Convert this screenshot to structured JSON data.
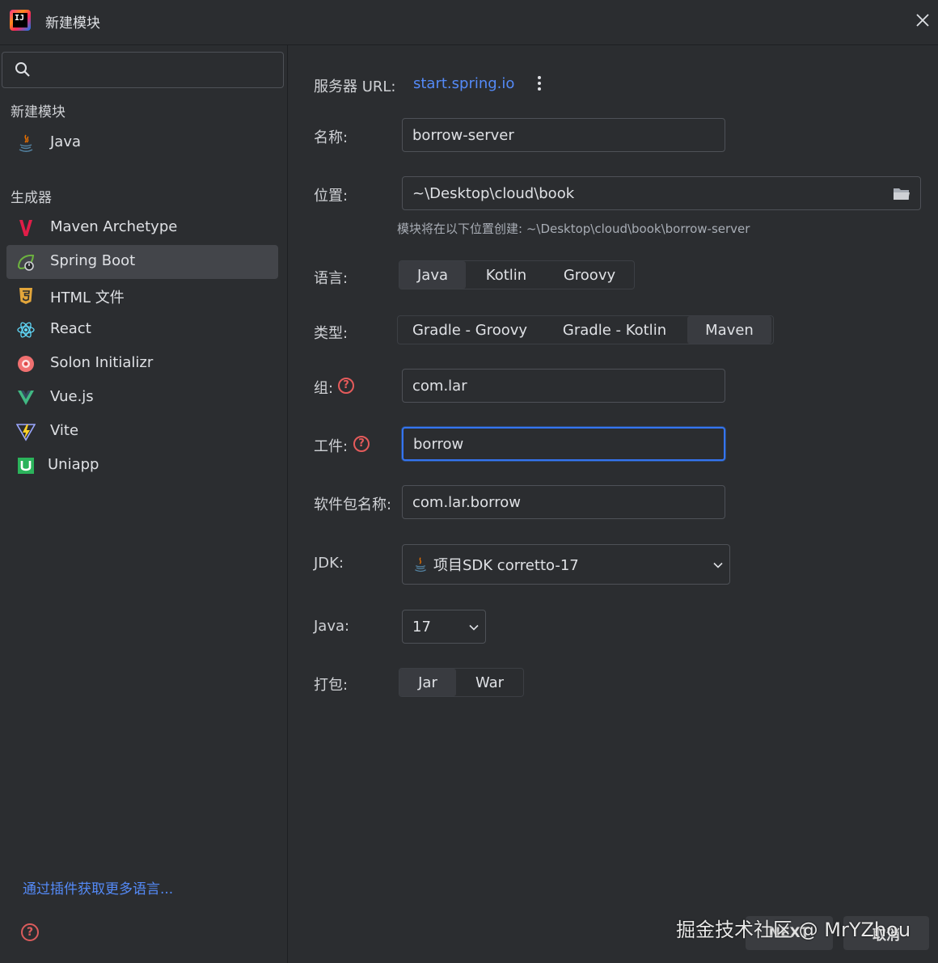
{
  "window": {
    "title": "新建模块",
    "logo_text": "IJ"
  },
  "sidebar": {
    "search": {
      "placeholder": ""
    },
    "section_new": "新建模块",
    "section_generators": "生成器",
    "items": [
      {
        "label": "Java",
        "icon": "java-icon"
      },
      {
        "label": "Maven Archetype",
        "icon": "maven-icon"
      },
      {
        "label": "Spring Boot",
        "icon": "spring-boot-icon",
        "selected": true
      },
      {
        "label": "HTML 文件",
        "icon": "html5-icon"
      },
      {
        "label": "React",
        "icon": "react-icon"
      },
      {
        "label": "Solon Initializr",
        "icon": "solon-icon"
      },
      {
        "label": "Vue.js",
        "icon": "vue-icon"
      },
      {
        "label": "Vite",
        "icon": "vite-icon"
      },
      {
        "label": "Uniapp",
        "icon": "uniapp-icon"
      }
    ],
    "plugins_link": "通过插件获取更多语言..."
  },
  "form": {
    "server_url_label": "服务器 URL:",
    "server_url": "start.spring.io",
    "name_label": "名称:",
    "name_value": "borrow-server",
    "location_label": "位置:",
    "location_value": "~\\Desktop\\cloud\\book",
    "location_hint": "模块将在以下位置创建: ~\\Desktop\\cloud\\book\\borrow-server",
    "language_label": "语言:",
    "languages": [
      "Java",
      "Kotlin",
      "Groovy"
    ],
    "language_selected": "Java",
    "type_label": "类型:",
    "types": [
      "Gradle - Groovy",
      "Gradle - Kotlin",
      "Maven"
    ],
    "type_selected": "Maven",
    "group_label": "组:",
    "group_value": "com.lar",
    "artifact_label": "工件:",
    "artifact_value": "borrow",
    "package_label": "软件包名称:",
    "package_value": "com.lar.borrow",
    "jdk_label": "JDK:",
    "jdk_value": "项目SDK corretto-17",
    "java_label": "Java:",
    "java_value": "17",
    "packaging_label": "打包:",
    "packagings": [
      "Jar",
      "War"
    ],
    "packaging_selected": "Jar"
  },
  "footer": {
    "next_label": "NEXT",
    "cancel_label": "取消",
    "watermark": "掘金技术社区 @ MrYZhou"
  },
  "colors": {
    "background": "#2b2d30",
    "accent": "#3574f0",
    "link": "#548af7",
    "help": "#e55b5b"
  }
}
